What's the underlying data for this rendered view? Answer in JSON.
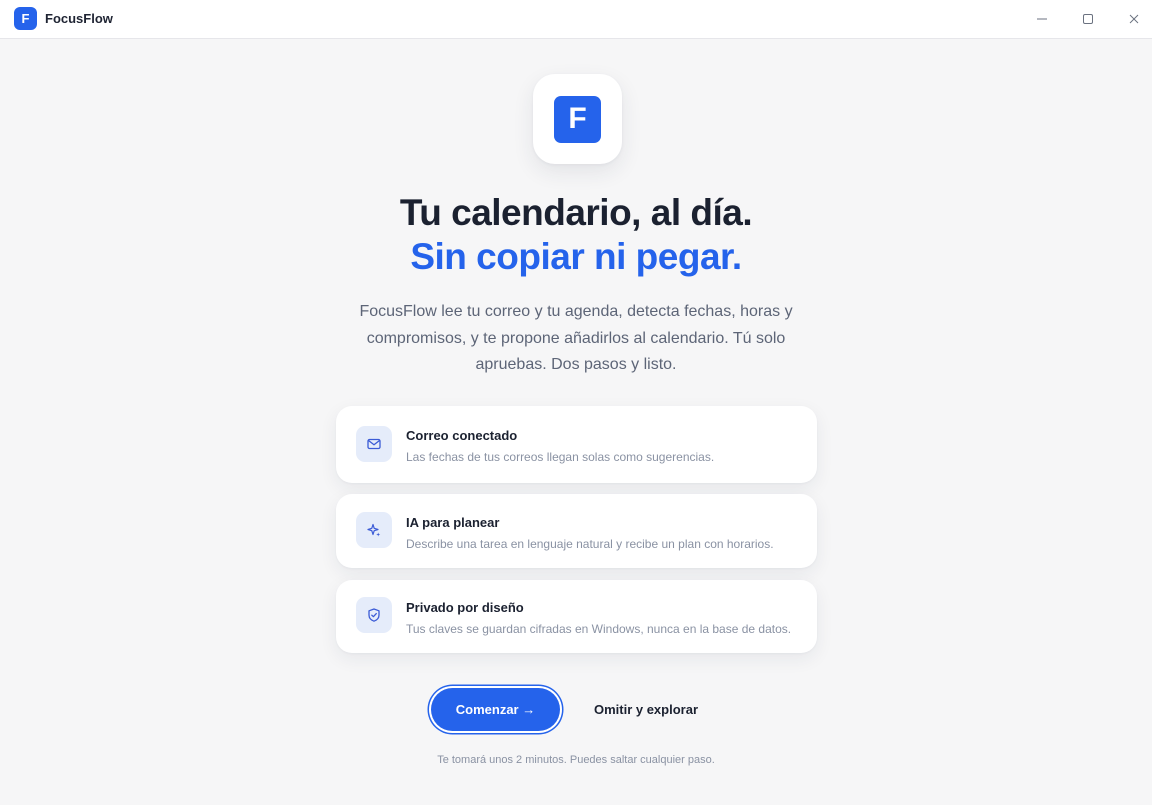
{
  "window": {
    "logo_letter": "F",
    "title": "FocusFlow",
    "controls": [
      "minimize-icon",
      "maximize-icon",
      "close-icon"
    ]
  },
  "hero": {
    "logo_letter": "F",
    "headline_line1": "Tu calendario, al día.",
    "headline_line2": "Sin copiar ni pegar.",
    "subtitle": "FocusFlow lee tu correo y tu agenda, detecta fechas, horas y compromisos, y te propone añadirlos al calendario. Tú solo apruebas. Dos pasos y listo."
  },
  "features": [
    {
      "icon": "mail-icon",
      "title": "Correo conectado",
      "description": "Las fechas de tus correos llegan solas como sugerencias."
    },
    {
      "icon": "sparkle-icon",
      "title": "IA para planear",
      "description": "Describe una tarea en lenguaje natural y recibe un plan con horarios."
    },
    {
      "icon": "shield-icon",
      "title": "Privado por diseño",
      "description": "Tus claves se guardan cifradas en Windows, nunca en la base de datos."
    }
  ],
  "actions": {
    "start_label": "Comenzar →",
    "skip_label": "Omitir y explorar"
  },
  "footnote": "Te tomará unos 2 minutos. Puedes saltar cualquier paso.",
  "colors": {
    "accent": "#2563eb",
    "background": "#f6f6f7",
    "icon_tile": "#e5ecfa",
    "text_dark": "#1b2130",
    "text_muted": "#8a92a3"
  }
}
